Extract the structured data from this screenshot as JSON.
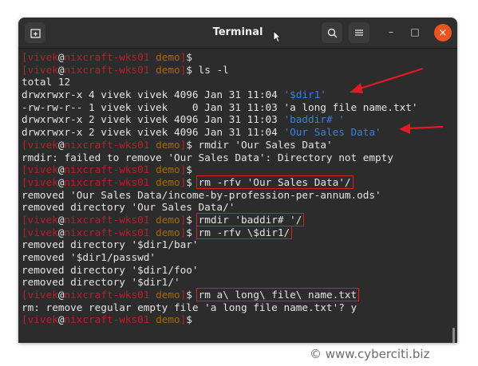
{
  "titlebar": {
    "title": "Terminal",
    "new_tab_icon": "new-tab-icon",
    "search_icon": "search-icon",
    "menu_icon": "hamburger-menu-icon",
    "minimize": "–",
    "maximize": "□",
    "close": "×"
  },
  "prompt": {
    "bracket_open": "[",
    "user": "vivek",
    "at": "@",
    "host": "nixcraft-wks01",
    "dir": "demo",
    "bracket_close": "]",
    "symbol": "$"
  },
  "lines": [
    {
      "type": "prompt",
      "cmd": ""
    },
    {
      "type": "prompt",
      "cmd": " ls -l"
    },
    {
      "type": "out",
      "text": "total 12"
    },
    {
      "type": "out",
      "text": "drwxrwxr-x 4 vivek vivek 4096 Jan 31 11:04 ",
      "blue": "'$dir1'"
    },
    {
      "type": "out",
      "text": "-rw-rw-r-- 1 vivek vivek    0 Jan 31 11:03 'a long file name.txt'"
    },
    {
      "type": "out",
      "text": "drwxrwxr-x 2 vivek vivek 4096 Jan 31 11:03 ",
      "blue": "'baddir# '"
    },
    {
      "type": "out",
      "text": "drwxrwxr-x 2 vivek vivek 4096 Jan 31 11:04 ",
      "blue": "'Our Sales Data'"
    },
    {
      "type": "prompt",
      "cmd": " rmdir 'Our Sales Data'"
    },
    {
      "type": "out",
      "text": "rmdir: failed to remove 'Our Sales Data': Directory not empty"
    },
    {
      "type": "prompt",
      "cmd": ""
    },
    {
      "type": "prompt",
      "cmd": "rm -rfv 'Our Sales Data'/",
      "boxed": true
    },
    {
      "type": "out",
      "text": "removed 'Our Sales Data/income-by-profession-per-annum.ods'"
    },
    {
      "type": "out",
      "text": "removed directory 'Our Sales Data/'"
    },
    {
      "type": "prompt",
      "cmd": "rmdir 'baddir# '/",
      "boxed": true
    },
    {
      "type": "prompt",
      "cmd": "rm -rfv \\$dir1/",
      "boxed": true
    },
    {
      "type": "out",
      "text": "removed directory '$dir1/bar'"
    },
    {
      "type": "out",
      "text": "removed '$dir1/passwd'"
    },
    {
      "type": "out",
      "text": "removed directory '$dir1/foo'"
    },
    {
      "type": "out",
      "text": "removed directory '$dir1/'"
    },
    {
      "type": "prompt",
      "cmd": "rm a\\ long\\ file\\ name.txt",
      "boxed": true
    },
    {
      "type": "out",
      "text": "rm: remove regular empty file 'a long file name.txt'? y"
    },
    {
      "type": "prompt",
      "cmd": ""
    }
  ],
  "colors": {
    "terminal_bg": "#2c2c2c",
    "prompt_red": "#c01c28",
    "dir_amber": "#a76b00",
    "dir_blue": "#3b7fe0",
    "annotation_red": "#e01b24",
    "close_orange": "#e95420"
  },
  "watermark": "© www.cyberciti.biz"
}
